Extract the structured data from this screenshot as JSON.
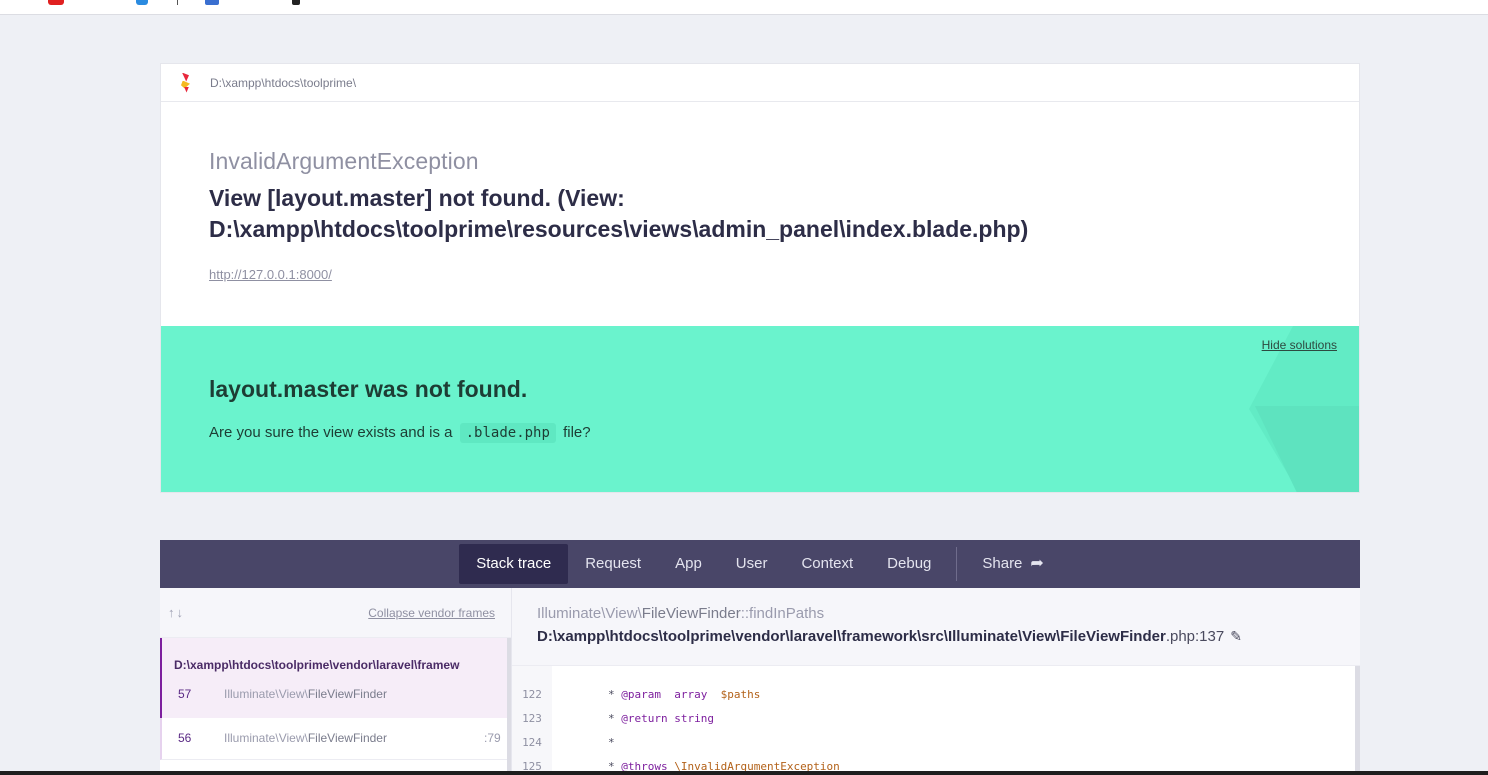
{
  "card": {
    "path": "D:\\xampp\\htdocs\\toolprime\\"
  },
  "exception": {
    "class": "InvalidArgumentException",
    "message": "View [layout.master] not found. (View: D:\\xampp\\htdocs\\toolprime\\resources\\views\\admin_panel\\index.blade.php)",
    "url": "http://127.0.0.1:8000/"
  },
  "solution": {
    "hide_label": "Hide solutions",
    "title": "layout.master was not found.",
    "desc_before": "Are you sure the view exists and is a",
    "desc_code": ".blade.php",
    "desc_after": "file?"
  },
  "nav": {
    "tabs": [
      "Stack trace",
      "Request",
      "App",
      "User",
      "Context",
      "Debug"
    ],
    "share": "Share"
  },
  "frames": {
    "arrows": "↑↓",
    "collapse_label": "Collapse vendor frames",
    "active": {
      "path": "D:\\xampp\\htdocs\\toolprime\\vendor\\laravel\\framework\\src\\Illuminate\\View\\FileViewFinder.php",
      "number": "57",
      "namespace": "Illuminate\\View\\",
      "class": "FileViewFinder"
    },
    "second": {
      "number": "56",
      "namespace": "Illuminate\\View\\",
      "class": "FileViewFinder",
      "line": ":79"
    }
  },
  "detail": {
    "namespace": "Illuminate\\View\\",
    "class": "FileViewFinder",
    "method": "::findInPaths",
    "file": "D:\\xampp\\htdocs\\toolprime\\vendor\\laravel\\framework\\src\\Illuminate\\View\\FileViewFinder",
    "file_ext": ".php:137"
  },
  "code_lines": [
    {
      "num": "122",
      "prefix": "* ",
      "tag": "@param",
      "type": "array",
      "var": "$paths"
    },
    {
      "num": "123",
      "prefix": "* ",
      "tag": "@return",
      "type": "string",
      "var": ""
    },
    {
      "num": "124",
      "prefix": "*",
      "tag": "",
      "type": "",
      "var": ""
    },
    {
      "num": "125",
      "prefix": "* ",
      "tag": "@throws",
      "type": "\\InvalidArgumentException",
      "var": ""
    }
  ],
  "colors": {
    "solution_bg": "#6af3cd",
    "nav_bg": "#494668",
    "nav_active": "#2f2b4f",
    "accent_purple": "#7d1f9e"
  }
}
